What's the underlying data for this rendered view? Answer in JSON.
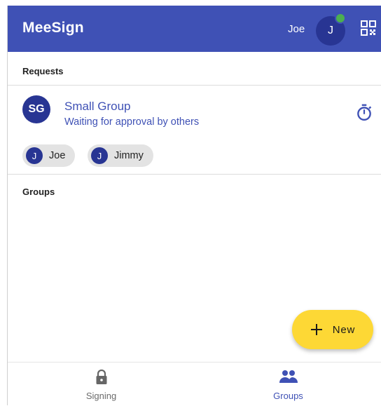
{
  "app_bar": {
    "title": "MeeSign",
    "user_name": "Joe",
    "user_initial": "J",
    "accent_color": "#3f51b5",
    "status_color": "#4caf50"
  },
  "requests": {
    "section_label": "Requests",
    "items": [
      {
        "initials": "SG",
        "title": "Small Group",
        "status": "Waiting for approval by others",
        "members": [
          {
            "initial": "J",
            "name": "Joe"
          },
          {
            "initial": "J",
            "name": "Jimmy"
          }
        ]
      }
    ]
  },
  "groups": {
    "section_label": "Groups"
  },
  "fab": {
    "icon": "plus-icon",
    "label": "New",
    "color": "#fdd835"
  },
  "bottom_nav": {
    "items": [
      {
        "icon": "lock-icon",
        "label": "Signing",
        "active": false
      },
      {
        "icon": "people-icon",
        "label": "Groups",
        "active": true
      }
    ]
  }
}
